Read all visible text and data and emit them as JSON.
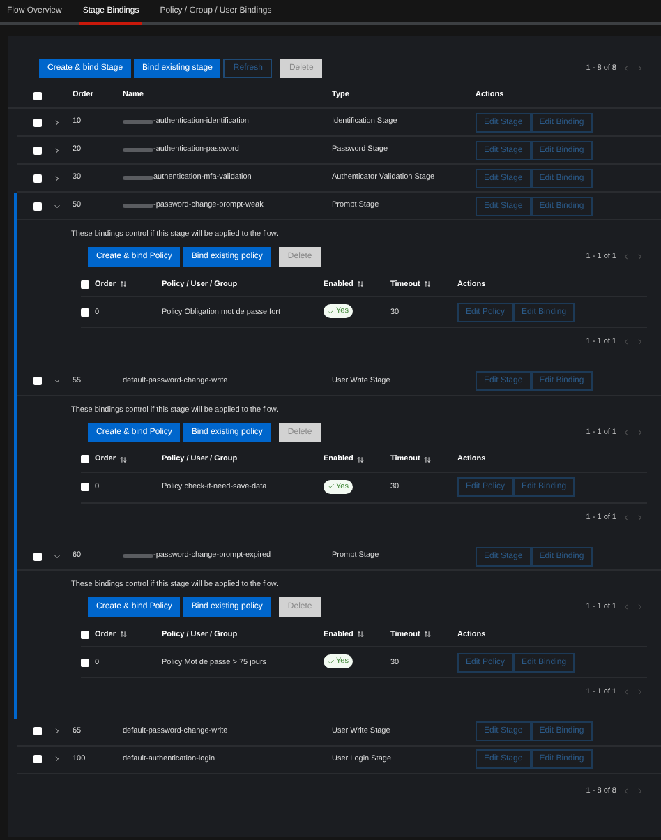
{
  "tabs": [
    {
      "label": "Flow Overview",
      "selected": false
    },
    {
      "label": "Stage Bindings",
      "selected": true
    },
    {
      "label": "Policy / Group / User Bindings",
      "selected": false
    }
  ],
  "toolbar": {
    "buttons": [
      {
        "label": "Create & bind Stage",
        "kind": "primary"
      },
      {
        "label": "Bind existing stage",
        "kind": "primary"
      },
      {
        "label": "Refresh",
        "kind": "outline"
      },
      {
        "label": "Delete",
        "kind": "disabled"
      }
    ],
    "pagination": "1 - 8 of 8"
  },
  "table": {
    "select_all_checked": false,
    "columns": [
      "Order",
      "Name",
      "Type",
      "Actions"
    ],
    "rows": [
      {
        "checked": false,
        "expanded": false,
        "order": "10",
        "redacted": true,
        "name": "-authentication-identification",
        "type": "Identification Stage",
        "actions": [
          "Edit Stage",
          "Edit Binding"
        ]
      },
      {
        "checked": false,
        "expanded": false,
        "order": "20",
        "redacted": true,
        "name": "-authentication-password",
        "type": "Password Stage",
        "actions": [
          "Edit Stage",
          "Edit Binding"
        ]
      },
      {
        "checked": false,
        "expanded": false,
        "order": "30",
        "redacted": true,
        "name": "authentication-mfa-validation",
        "type": "Authenticator Validation Stage",
        "actions": [
          "Edit Stage",
          "Edit Binding"
        ]
      },
      {
        "checked": false,
        "expanded": true,
        "order": "50",
        "redacted": true,
        "name": "-password-change-prompt-weak",
        "type": "Prompt Stage",
        "actions": [
          "Edit Stage",
          "Edit Binding"
        ],
        "bindings": {
          "description": "These bindings control if this stage will be applied to the flow.",
          "buttons": [
            {
              "label": "Create & bind Policy",
              "kind": "primary"
            },
            {
              "label": "Bind existing policy",
              "kind": "primary"
            },
            {
              "label": "Delete",
              "kind": "disabled"
            }
          ],
          "pagination_top": "1 - 1 of 1",
          "select_all_checked": false,
          "columns": [
            {
              "label": "Order",
              "sortable": true
            },
            {
              "label": "Policy / User / Group",
              "sortable": false
            },
            {
              "label": "Enabled",
              "sortable": true
            },
            {
              "label": "Timeout",
              "sortable": true
            },
            {
              "label": "Actions",
              "sortable": false
            }
          ],
          "rows": [
            {
              "checked": false,
              "order": "0",
              "policy": "Policy Obligation mot de passe fort",
              "enabled": true,
              "enabled_label": "Yes",
              "timeout": "30",
              "actions": [
                "Edit Policy",
                "Edit Binding"
              ]
            }
          ],
          "pagination_bottom": "1 - 1 of 1"
        }
      },
      {
        "checked": false,
        "expanded": true,
        "order": "55",
        "redacted": false,
        "name": "default-password-change-write",
        "type": "User Write Stage",
        "actions": [
          "Edit Stage",
          "Edit Binding"
        ],
        "bindings": {
          "description": "These bindings control if this stage will be applied to the flow.",
          "buttons": [
            {
              "label": "Create & bind Policy",
              "kind": "primary"
            },
            {
              "label": "Bind existing policy",
              "kind": "primary"
            },
            {
              "label": "Delete",
              "kind": "disabled"
            }
          ],
          "pagination_top": "1 - 1 of 1",
          "select_all_checked": false,
          "columns": [
            {
              "label": "Order",
              "sortable": true
            },
            {
              "label": "Policy / User / Group",
              "sortable": false
            },
            {
              "label": "Enabled",
              "sortable": true
            },
            {
              "label": "Timeout",
              "sortable": true
            },
            {
              "label": "Actions",
              "sortable": false
            }
          ],
          "rows": [
            {
              "checked": false,
              "order": "0",
              "policy": "Policy check-if-need-save-data",
              "enabled": true,
              "enabled_label": "Yes",
              "timeout": "30",
              "actions": [
                "Edit Policy",
                "Edit Binding"
              ]
            }
          ],
          "pagination_bottom": "1 - 1 of 1"
        }
      },
      {
        "checked": false,
        "expanded": true,
        "order": "60",
        "redacted": true,
        "name": "-password-change-prompt-expired",
        "type": "Prompt Stage",
        "actions": [
          "Edit Stage",
          "Edit Binding"
        ],
        "bindings": {
          "description": "These bindings control if this stage will be applied to the flow.",
          "buttons": [
            {
              "label": "Create & bind Policy",
              "kind": "primary"
            },
            {
              "label": "Bind existing policy",
              "kind": "primary"
            },
            {
              "label": "Delete",
              "kind": "disabled"
            }
          ],
          "pagination_top": "1 - 1 of 1",
          "select_all_checked": false,
          "columns": [
            {
              "label": "Order",
              "sortable": true
            },
            {
              "label": "Policy / User / Group",
              "sortable": false
            },
            {
              "label": "Enabled",
              "sortable": true
            },
            {
              "label": "Timeout",
              "sortable": true
            },
            {
              "label": "Actions",
              "sortable": false
            }
          ],
          "rows": [
            {
              "checked": false,
              "order": "0",
              "policy": "Policy Mot de passe > 75 jours",
              "enabled": true,
              "enabled_label": "Yes",
              "timeout": "30",
              "actions": [
                "Edit Policy",
                "Edit Binding"
              ]
            }
          ],
          "pagination_bottom": "1 - 1 of 1"
        }
      },
      {
        "checked": false,
        "expanded": false,
        "order": "65",
        "redacted": false,
        "name": "default-password-change-write",
        "type": "User Write Stage",
        "actions": [
          "Edit Stage",
          "Edit Binding"
        ]
      },
      {
        "checked": false,
        "expanded": false,
        "order": "100",
        "redacted": false,
        "name": "default-authentication-login",
        "type": "User Login Stage",
        "actions": [
          "Edit Stage",
          "Edit Binding"
        ]
      }
    ],
    "pagination": "1 - 8 of 8"
  }
}
